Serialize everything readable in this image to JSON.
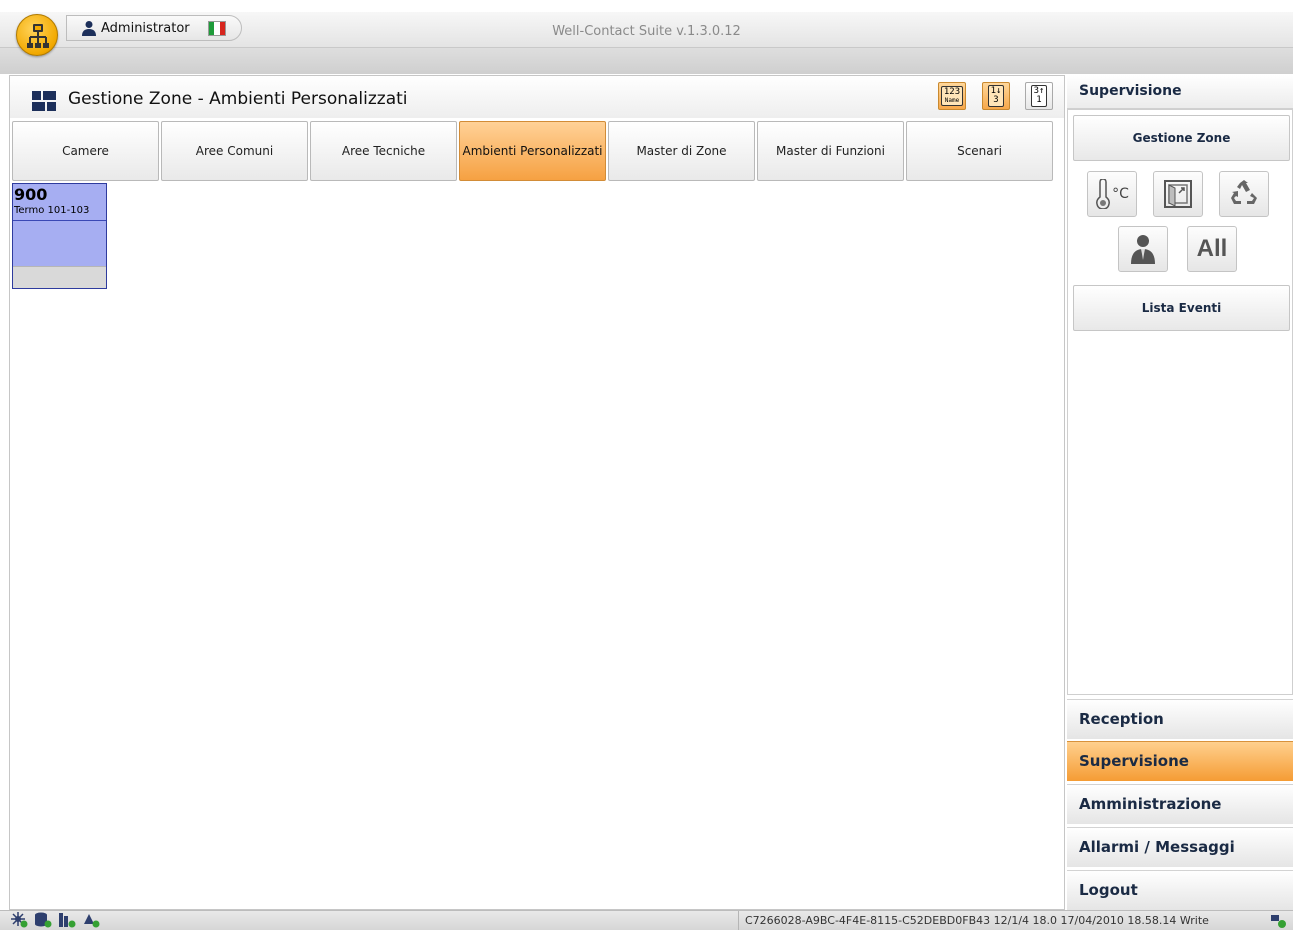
{
  "titlebar": {
    "user_name": "Administrator",
    "window_title": "Well-Contact Suite v.1.3.0.12",
    "flag_colors": [
      "#1f9b3a",
      "#ffffff",
      "#d7261e"
    ]
  },
  "main": {
    "title": "Gestione Zone - Ambienti Personalizzati",
    "sort_buttons": [
      {
        "icon": "sort-by-name-icon",
        "glyph_top": "123",
        "glyph_bottom": "Name"
      },
      {
        "icon": "sort-ascending-icon",
        "glyph_top": "1↓",
        "glyph_bottom": "3"
      },
      {
        "icon": "sort-descending-icon",
        "glyph_top": "3↑",
        "glyph_bottom": "1"
      }
    ],
    "tabs": [
      {
        "label": "Camere"
      },
      {
        "label": "Aree Comuni"
      },
      {
        "label": "Aree Tecniche"
      },
      {
        "label": "Ambienti Personalizzati"
      },
      {
        "label": "Master di Zone"
      },
      {
        "label": "Master di Funzioni"
      },
      {
        "label": "Scenari"
      }
    ],
    "active_tab": "Ambienti Personalizzati",
    "zones": [
      {
        "number": "900",
        "description": "Termo 101-103",
        "color": "#a6aef2"
      }
    ]
  },
  "sidebar": {
    "title": "Supervisione",
    "gestione_zone_label": "Gestione Zone",
    "filter_icons": [
      "thermometer-icon",
      "window-icon",
      "recycle-icon",
      "person-icon",
      "all-filter-icon"
    ],
    "temp_unit": "°C",
    "all_label": "All",
    "lista_eventi_label": "Lista Eventi",
    "nav": [
      {
        "label": "Reception"
      },
      {
        "label": "Supervisione"
      },
      {
        "label": "Amministrazione"
      },
      {
        "label": "Allarmi / Messaggi"
      },
      {
        "label": "Logout"
      }
    ],
    "active_nav": "Supervisione"
  },
  "statusbar": {
    "text": "C7266028-A9BC-4F4E-8115-C52DEBD0FB43 12/1/4 18.0 17/04/2010 18.58.14 Write",
    "icons": [
      "network-icon",
      "database-icon",
      "server-icon",
      "sync-icon",
      "connection-icon"
    ]
  },
  "colors": {
    "accent_orange": "#f6a142",
    "zone_blue": "#a6aef2",
    "title_navy": "#1a2a44"
  }
}
